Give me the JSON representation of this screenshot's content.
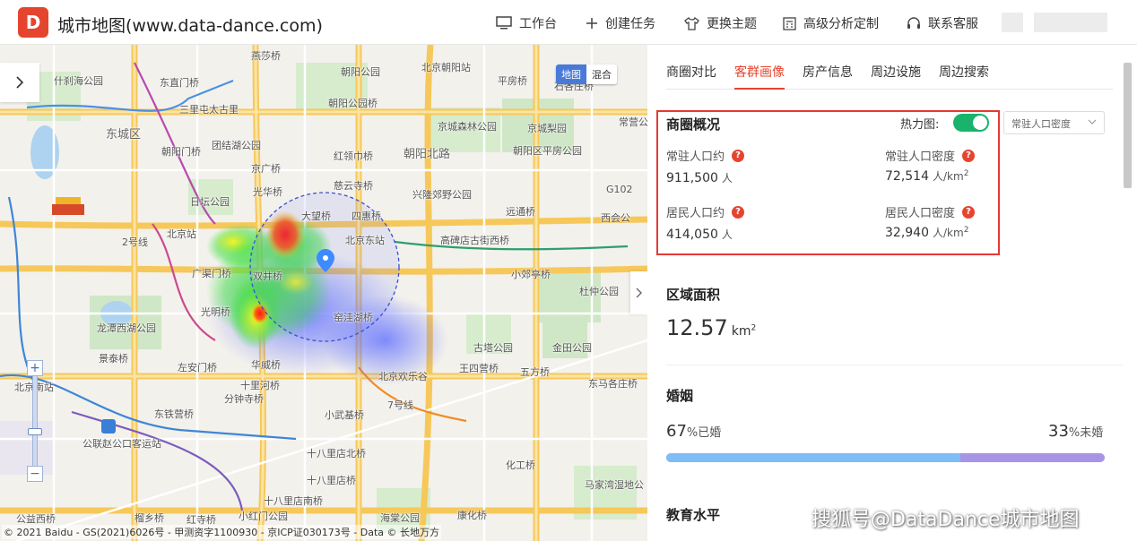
{
  "header": {
    "logo_text": "D",
    "title": "城市地图(www.data-dance.com)",
    "nav": [
      {
        "label": "工作台",
        "icon": "monitor-icon"
      },
      {
        "label": "创建任务",
        "icon": "plus-icon"
      },
      {
        "label": "更换主题",
        "icon": "shirt-icon"
      },
      {
        "label": "高级分析定制",
        "icon": "calculator-icon"
      },
      {
        "label": "联系客服",
        "icon": "headset-icon"
      }
    ]
  },
  "map": {
    "mode_buttons": [
      "地图",
      "混合"
    ],
    "active_mode": "地图",
    "zoom_in": "+",
    "zoom_out": "−",
    "copyright": "© 2021 Baidu - GS(2021)6026号 - 甲测资字1100930 - 京ICP证030173号 - Data © 长地万方",
    "labels": [
      "燕莎桥",
      "朝阳公园",
      "北京朝阳站",
      "什刹海公园",
      "东直门桥",
      "朝阳公园桥",
      "平房桥",
      "石各庄桥",
      "东城区",
      "三里屯太古里",
      "京城森林公园",
      "京城梨园",
      "常营公",
      "朝阳门桥",
      "团结湖公园",
      "红领巾桥",
      "朝阳北路",
      "朝阳区平房公园",
      "京广桥",
      "日坛公园",
      "慈云寺桥",
      "光华桥",
      "兴隆郊野公园",
      "大望桥",
      "四惠桥",
      "远通桥",
      "西会公",
      "北京站",
      "北京东站",
      "高碑店古街西桥",
      "广渠门桥",
      "双井桥",
      "小郊亭桥",
      "杜仲公园",
      "光明桥",
      "窑洼湖桥",
      "龙潭西湖公园",
      "古塔公园",
      "金田公园",
      "景泰桥",
      "左安门桥",
      "华威桥",
      "北京欢乐谷",
      "王四营桥",
      "五方桥",
      "东马各庄桥",
      "北京南站",
      "十里河桥",
      "分钟寺桥",
      "东铁营桥",
      "小武基桥",
      "7号线",
      "公联赵公口客运站",
      "十八里店北桥",
      "化工桥",
      "十八里店桥",
      "马家湾湿地公",
      "十八里店南桥",
      "公益西桥",
      "榴乡桥",
      "红寺桥",
      "小红门公园",
      "海棠公园",
      "康化桥",
      "2号线",
      "G102",
      "北京南站"
    ]
  },
  "panel": {
    "tabs": [
      "商圈对比",
      "客群画像",
      "房产信息",
      "周边设施",
      "周边搜索"
    ],
    "active_tab": "客群画像",
    "overview": {
      "title": "商圈概况",
      "heatmap_label": "热力图:",
      "heatmap_on": true,
      "select_value": "常驻人口密度",
      "metrics": [
        {
          "label": "常驻人口约",
          "value": "911,500",
          "unit": "人"
        },
        {
          "label": "常驻人口密度",
          "value": "72,514",
          "unit": "人/km",
          "sup": "2"
        },
        {
          "label": "居民人口约",
          "value": "414,050",
          "unit": "人"
        },
        {
          "label": "居民人口密度",
          "value": "32,940",
          "unit": "人/km",
          "sup": "2"
        }
      ]
    },
    "area": {
      "title": "区域面积",
      "value": "12.57",
      "unit": "km",
      "sup": "2"
    },
    "marriage": {
      "title": "婚姻",
      "married_pct": 67,
      "married_text": "67",
      "married_label": "%已婚",
      "unmarried_text": "33",
      "unmarried_label": "%未婚"
    },
    "education": {
      "title": "教育水平"
    }
  },
  "watermark": "搜狐号@DataDance城市地图",
  "colors": {
    "accent": "#e5452f",
    "toggle_on": "#19b36b",
    "married": "#7fbdf7",
    "unmarried": "#a894e6",
    "highlight_border": "#e53935"
  }
}
